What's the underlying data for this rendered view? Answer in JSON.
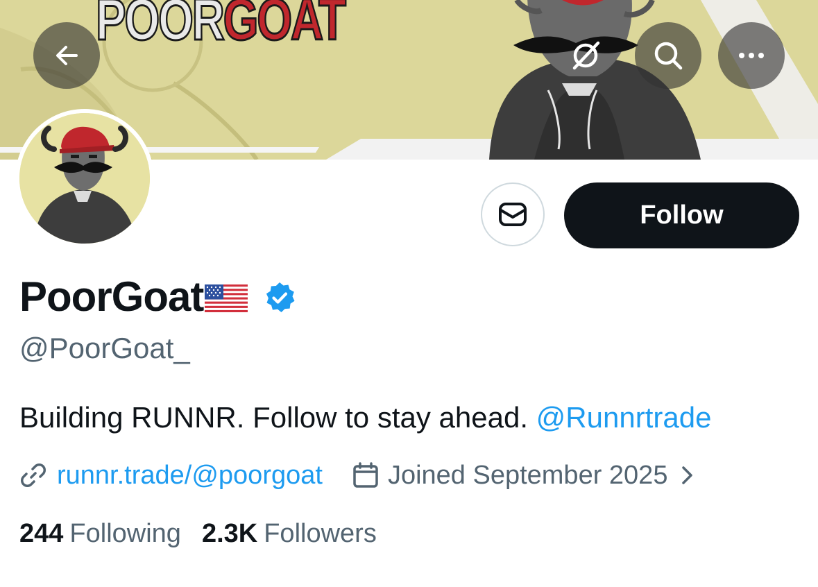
{
  "banner": {
    "title_part1": "POOR",
    "title_part2": "GOAT",
    "colors": {
      "background": "#dcd79a",
      "title_red": "#c0272d"
    }
  },
  "nav": {
    "back_icon": "arrow-left-icon",
    "grok_icon": "grok-icon",
    "search_icon": "search-icon",
    "more_icon": "more-horizontal-icon"
  },
  "actions": {
    "message_icon": "envelope-icon",
    "follow_label": "Follow"
  },
  "profile": {
    "display_name": "PoorGoat",
    "flag_icon": "us-flag-icon",
    "verified_icon": "verified-badge-icon",
    "handle": "@PoorGoat_",
    "bio_text": "Building RUNNR. Follow to stay ahead. ",
    "bio_mention": "@Runnrtrade",
    "website": "runnr.trade/@poorgoat",
    "joined": "Joined September 2025",
    "colors": {
      "accent": "#1d9bf0",
      "secondary_text": "#536471"
    }
  },
  "stats": {
    "following_count": "244",
    "following_label": "Following",
    "followers_count": "2.3K",
    "followers_label": "Followers"
  }
}
